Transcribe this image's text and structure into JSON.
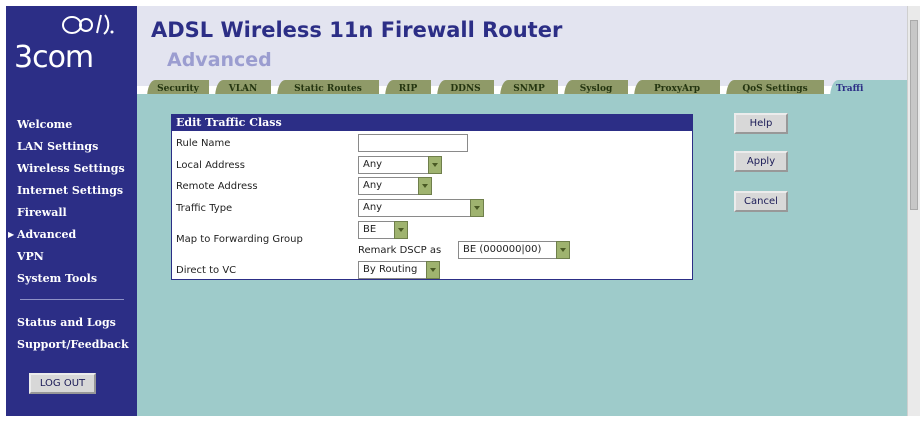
{
  "brand": {
    "name": "3com",
    "logo_icon": "3com-logo-icon"
  },
  "header": {
    "title": "ADSL Wireless 11n Firewall Router",
    "subtitle": "Advanced"
  },
  "tabs": [
    {
      "label": "Security"
    },
    {
      "label": "VLAN"
    },
    {
      "label": "Static Routes"
    },
    {
      "label": "RIP"
    },
    {
      "label": "DDNS"
    },
    {
      "label": "SNMP"
    },
    {
      "label": "Syslog"
    },
    {
      "label": "ProxyArp"
    },
    {
      "label": "QoS Settings"
    },
    {
      "label": "Traffi",
      "active": true
    }
  ],
  "sidebar": {
    "items": [
      {
        "label": "Welcome"
      },
      {
        "label": "LAN Settings"
      },
      {
        "label": "Wireless Settings"
      },
      {
        "label": "Internet Settings"
      },
      {
        "label": "Firewall"
      },
      {
        "label": "Advanced",
        "active": true
      },
      {
        "label": "VPN"
      },
      {
        "label": "System Tools"
      },
      {
        "label": "Status and Logs"
      },
      {
        "label": "Support/Feedback"
      }
    ],
    "logout_label": "LOG OUT"
  },
  "form": {
    "title": "Edit Traffic Class",
    "rule_name": {
      "label": "Rule Name",
      "value": ""
    },
    "local_address": {
      "label": "Local Address",
      "value": "Any"
    },
    "remote_address": {
      "label": "Remote Address",
      "value": "Any"
    },
    "traffic_type": {
      "label": "Traffic Type",
      "value": "Any"
    },
    "forwarding_group": {
      "label": "Map to Forwarding Group",
      "value": "BE"
    },
    "remark_dscp": {
      "label": "Remark DSCP as",
      "value": "BE (000000|00)"
    },
    "direct_to_vc": {
      "label": "Direct to VC",
      "value": "By Routing"
    }
  },
  "actions": {
    "help": "Help",
    "apply": "Apply",
    "cancel": "Cancel"
  },
  "colors": {
    "sidebar": "#2c2e86",
    "content_bg": "#9ecbca",
    "header_bg": "#e3e4f0",
    "tab_bg": "#8f9a68",
    "dropdown_arrow": "#9fb36f"
  }
}
